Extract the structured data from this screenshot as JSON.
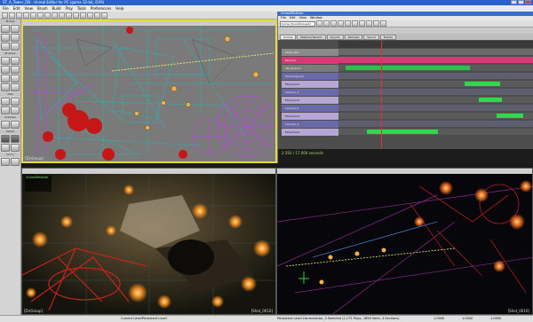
{
  "window": {
    "title": "ST_A_Tower_DB - Unreal Editor for PC (game 32-bit, DX9)"
  },
  "menu": [
    "File",
    "Edit",
    "View",
    "Brush",
    "Build",
    "Play",
    "Tools",
    "Preferences",
    "Help"
  ],
  "palette": {
    "sections": [
      "Modes",
      "Brushes",
      "CSG",
      "Volumes",
      "Select",
      "Go to"
    ]
  },
  "matinee": {
    "title": "UnrealMatinee",
    "menu": [
      "File",
      "Edit",
      "View",
      "Window"
    ],
    "combo": "Curve (SoundGroupA)",
    "tabs": [
      "Curves",
      "Material Params",
      "Sounds",
      "Particles",
      "Sound",
      "Events"
    ],
    "tracks": [
      {
        "name": "Level_stat",
        "color": "#8a8a8a"
      },
      {
        "name": "Director",
        "color": "#d83a75"
      },
      {
        "name": "SM_Director",
        "color": "#7b7b7b"
      },
      {
        "name": "Directorgroup",
        "color": "#6a6aa8"
      },
      {
        "name": "Movement",
        "color": "#b6a6d6"
      },
      {
        "name": "Camera_1",
        "color": "#6a6aa8"
      },
      {
        "name": "Movement",
        "color": "#b6a6d6"
      },
      {
        "name": "Camera_2",
        "color": "#6a6aa8"
      },
      {
        "name": "Movement",
        "color": "#b6a6d6"
      },
      {
        "name": "Camera_3",
        "color": "#6a6aa8"
      },
      {
        "name": "Movement",
        "color": "#b6a6d6"
      }
    ],
    "status": "2.593 / 17.000 seconds"
  },
  "viewports": {
    "top_label": "[DirGroup]",
    "bottom_left_label": "[DirGroup]",
    "bottom_left_label_right": "[Shot_0010]",
    "bottom_right_label": "[Shot_0010]",
    "overlay_title": "UnrealMatinee"
  },
  "statusbar": {
    "current_level": "Current Level:",
    "level_name": "Persistent Level",
    "selection": "Persistent Level.CameraActor_3 Selected (2,175 Polys, 1856 Verts, 4 Sections)",
    "grid_values": [
      "1.0000",
      "1.0000",
      "1.0000"
    ]
  },
  "colors": {
    "accent_selected": "#e5d84a",
    "director_track": "#d83a75",
    "active_key": "#35d64f"
  }
}
